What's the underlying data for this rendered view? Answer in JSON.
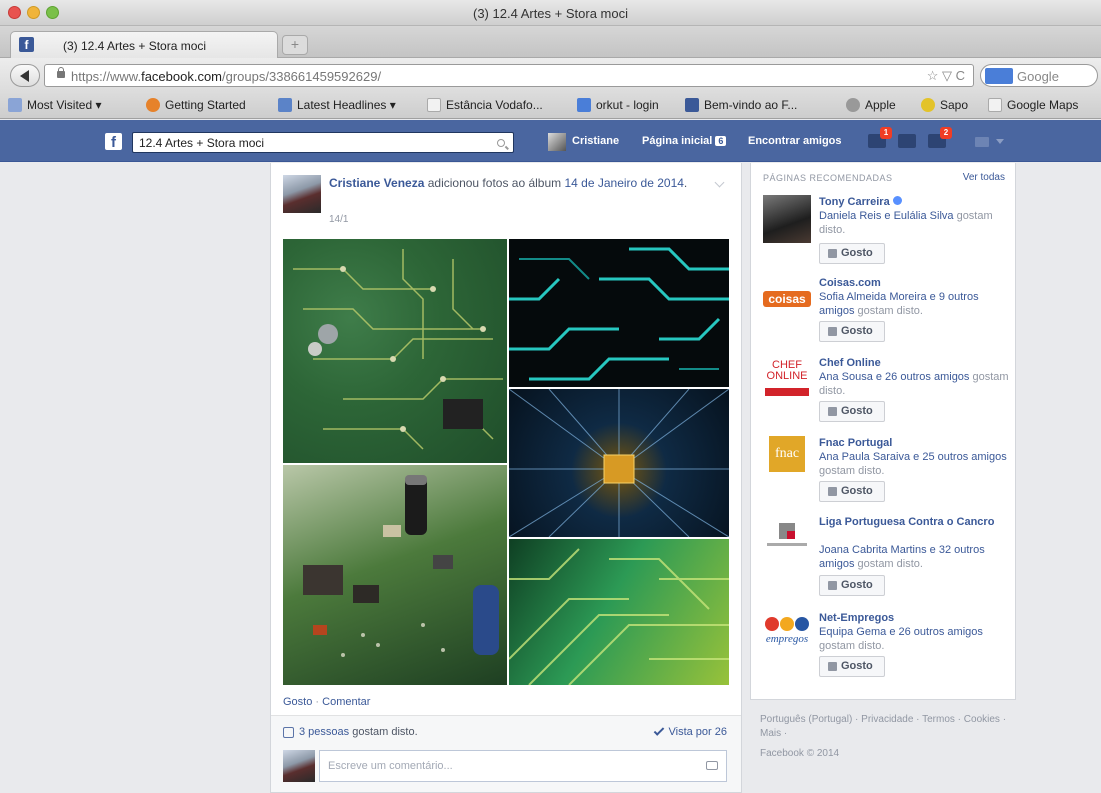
{
  "window": {
    "title": "(3) 12.4 Artes + Stora moci"
  },
  "tab": {
    "label": "(3) 12.4 Artes + Stora moci",
    "close": "×",
    "new_tab": "+"
  },
  "nav": {
    "url_prefix": "https://www.",
    "url_domain": "facebook.com",
    "url_path": "/groups/338661459592629/",
    "url_right": "☆ ▽ C",
    "search_engine": "Google"
  },
  "bookmarks": [
    "Most Visited ▾",
    "Getting Started",
    "Latest Headlines ▾",
    "Estância Vodafo...",
    "orkut - login",
    "Bem-vindo ao F...",
    "Apple",
    "Sapo",
    "Google Maps"
  ],
  "fb_header": {
    "search_value": "12.4 Artes + Stora moci",
    "profile": "Cristiane",
    "home": "Página inicial",
    "home_count": "6",
    "find_friends": "Encontrar amigos",
    "friend_requests_badge": "1",
    "notifications_badge": "2"
  },
  "post": {
    "author": "Cristiane Veneza",
    "action": " adicionou fotos ao álbum ",
    "album": "14 de Janeiro de 2014",
    "trail": ".",
    "date": "14/1",
    "like_link": "Gosto",
    "sep": " · ",
    "comment_link": "Comentar",
    "likes_count": "3 pessoas",
    "likes_suffix": " gostam disto.",
    "seen": "Vista por 26",
    "comment_placeholder": "Escreve um comentário..."
  },
  "sidebar": {
    "title": "PÁGINAS RECOMENDADAS",
    "see_all": "Ver todas",
    "like_label": "Gosto",
    "items": [
      {
        "name": "Tony Carreira",
        "friends": "Daniela Reis e Eulália Silva",
        "suffix": " gostam disto."
      },
      {
        "name": "Coisas.com",
        "friends": "Sofia Almeida Moreira e 9 outros amigos",
        "suffix": " gostam disto."
      },
      {
        "name": "Chef Online",
        "friends": "Ana Sousa e 26 outros amigos",
        "suffix": " gostam disto."
      },
      {
        "name": "Fnac Portugal",
        "friends": "Ana Paula Saraiva e 25 outros amigos",
        "suffix": " gostam disto."
      },
      {
        "name": "Liga Portuguesa Contra o Cancro",
        "friends": "Joana Cabrita Martins e 32 outros amigos",
        "suffix": " gostam disto."
      },
      {
        "name": "Net-Empregos",
        "friends": "Equipa Gema e 26 outros amigos",
        "suffix": " gostam disto."
      }
    ],
    "logos": {
      "coisas": "coisas",
      "chef": "CHEF ONLINE",
      "fnac": "fnac",
      "net": "empregos"
    }
  },
  "footer": {
    "links": "Português (Portugal) · Privacidade · Termos · Cookies · Mais ·",
    "copyright": "Facebook © 2014"
  },
  "colors": {
    "facebook_blue": "#3b5998",
    "header": "#4a66a0",
    "badge": "#f03d25"
  }
}
